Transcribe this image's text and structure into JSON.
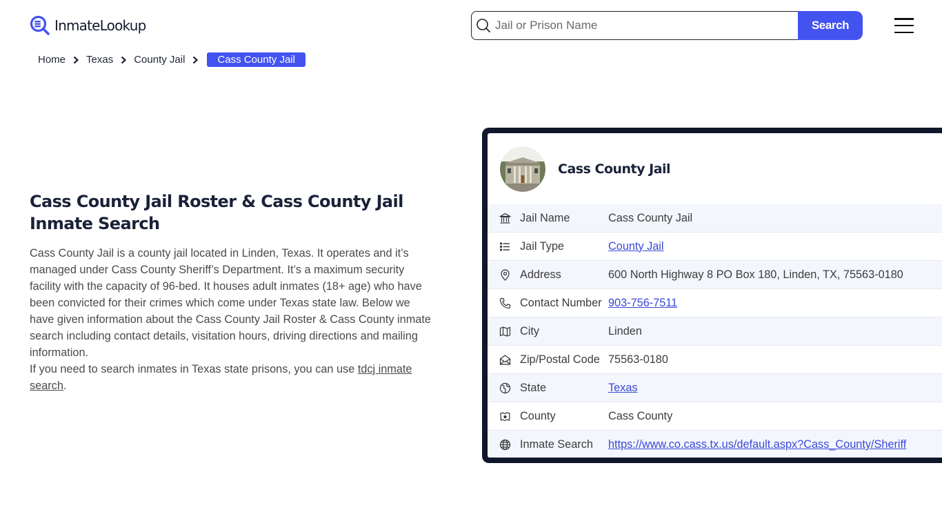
{
  "header": {
    "logo_text": "InmateLookup",
    "search": {
      "placeholder": "Jail or Prison Name",
      "value": "",
      "button_label": "Search"
    },
    "menu_icon": "hamburger-menu-icon"
  },
  "breadcrumb": {
    "items": [
      "Home",
      "Texas",
      "County Jail"
    ],
    "current": "Cass County Jail"
  },
  "main": {
    "title": "Cass County Jail Roster & Cass County Jail Inmate Search",
    "paragraph1": "Cass County Jail is a county jail located in Linden, Texas. It operates and it’s managed under Cass County Sheriff’s Department. It’s a maximum security facility with the capacity of 96-bed. It houses adult inmates (18+ age) who have been convicted for their crimes which come under Texas state law. Below we have given information about the Cass County Jail Roster & Cass County inmate search including contact details, visitation hours, driving directions and mailing information.",
    "paragraph2_prefix": "If you need to search inmates in Texas state prisons, you can use ",
    "paragraph2_link": "tdcj inmate search",
    "paragraph2_suffix": "."
  },
  "card": {
    "title": "Cass County Jail",
    "rows": [
      {
        "icon": "bank-building-icon",
        "label": "Jail Name",
        "value": "Cass County Jail",
        "link": false
      },
      {
        "icon": "list-icon",
        "label": "Jail Type",
        "value": "County Jail",
        "link": true
      },
      {
        "icon": "map-pin-icon",
        "label": "Address",
        "value": "600 North Highway 8 PO Box 180, Linden, TX, 75563-0180",
        "link": false
      },
      {
        "icon": "phone-icon",
        "label": "Contact Number",
        "value": "903-756-7511",
        "link": true
      },
      {
        "icon": "map-icon",
        "label": "City",
        "value": "Linden",
        "link": false
      },
      {
        "icon": "mail-open-icon",
        "label": "Zip/Postal Code",
        "value": "75563-0180",
        "link": false
      },
      {
        "icon": "globe-region-icon",
        "label": "State",
        "value": "Texas",
        "link": true
      },
      {
        "icon": "county-map-icon",
        "label": "County",
        "value": "Cass County",
        "link": false
      },
      {
        "icon": "world-icon",
        "label": "Inmate Search",
        "value": "https://www.co.cass.tx.us/default.aspx?Cass_County/Sheriff",
        "link": true
      }
    ]
  },
  "colors": {
    "brand": "#4353f0",
    "card_border": "#0f172a",
    "link": "#3a49d6",
    "row_alt": "#f4f6fd"
  }
}
